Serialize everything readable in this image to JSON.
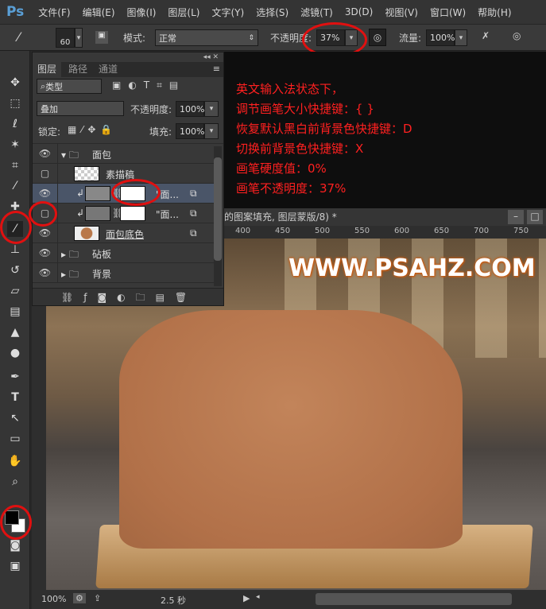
{
  "app": {
    "logo": "Ps"
  },
  "menu": [
    "文件(F)",
    "编辑(E)",
    "图像(I)",
    "图层(L)",
    "文字(Y)",
    "选择(S)",
    "滤镜(T)",
    "3D(D)",
    "视图(V)",
    "窗口(W)",
    "帮助(H)"
  ],
  "options": {
    "brush_size": "60",
    "mode_label": "模式:",
    "mode_value": "正常",
    "opacity_label": "不透明度:",
    "opacity_value": "37%",
    "flow_label": "流量:",
    "flow_value": "100%"
  },
  "layers_panel": {
    "tabs": [
      "图层",
      "路径",
      "通道"
    ],
    "filter_value": "类型",
    "blend_mode": "叠加",
    "opacity_label": "不透明度:",
    "opacity_value": "100%",
    "lock_label": "锁定:",
    "fill_label": "填充:",
    "fill_value": "100%",
    "layers": [
      {
        "name": "面包",
        "type": "group",
        "visible": true,
        "expanded": true
      },
      {
        "name": "素描稿",
        "type": "layer",
        "visible": false
      },
      {
        "name": "\"面...",
        "type": "pattern-fill-mask",
        "visible": true,
        "selected": true
      },
      {
        "name": "\"面...",
        "type": "pattern-fill-mask",
        "visible": false
      },
      {
        "name": "面包底色",
        "type": "layer",
        "visible": true
      },
      {
        "name": "砧板",
        "type": "group",
        "visible": true,
        "expanded": false
      },
      {
        "name": "背景",
        "type": "group",
        "visible": true,
        "expanded": false
      }
    ]
  },
  "tips": [
    "英文输入法状态下，",
    "调节画笔大小快捷键：{ }",
    "恢复默认黑白前背景色快捷键：D",
    "切换前背景色快捷键：X",
    "画笔硬度值：0%",
    "画笔不透明度：37%"
  ],
  "document": {
    "title": "的图案填充, 图层蒙版/8) *",
    "ruler_ticks": [
      "400",
      "450",
      "500",
      "550",
      "600",
      "650",
      "700",
      "750"
    ],
    "watermark": "WWW.PSAHZ.COM"
  },
  "status": {
    "zoom": "100%",
    "time": "2.5 秒"
  },
  "colors": {
    "annotation": "#e01010",
    "bread": "#b9784a",
    "accent": "#5a9fd6"
  }
}
